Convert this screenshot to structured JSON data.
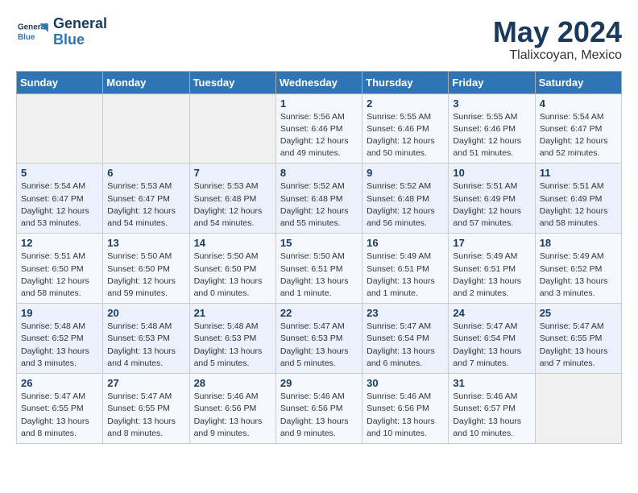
{
  "header": {
    "logo_line1": "General",
    "logo_line2": "Blue",
    "title": "May 2024",
    "subtitle": "Tlalixcoyan, Mexico"
  },
  "weekdays": [
    "Sunday",
    "Monday",
    "Tuesday",
    "Wednesday",
    "Thursday",
    "Friday",
    "Saturday"
  ],
  "weeks": [
    [
      {
        "day": "",
        "info": ""
      },
      {
        "day": "",
        "info": ""
      },
      {
        "day": "",
        "info": ""
      },
      {
        "day": "1",
        "info": "Sunrise: 5:56 AM\nSunset: 6:46 PM\nDaylight: 12 hours\nand 49 minutes."
      },
      {
        "day": "2",
        "info": "Sunrise: 5:55 AM\nSunset: 6:46 PM\nDaylight: 12 hours\nand 50 minutes."
      },
      {
        "day": "3",
        "info": "Sunrise: 5:55 AM\nSunset: 6:46 PM\nDaylight: 12 hours\nand 51 minutes."
      },
      {
        "day": "4",
        "info": "Sunrise: 5:54 AM\nSunset: 6:47 PM\nDaylight: 12 hours\nand 52 minutes."
      }
    ],
    [
      {
        "day": "5",
        "info": "Sunrise: 5:54 AM\nSunset: 6:47 PM\nDaylight: 12 hours\nand 53 minutes."
      },
      {
        "day": "6",
        "info": "Sunrise: 5:53 AM\nSunset: 6:47 PM\nDaylight: 12 hours\nand 54 minutes."
      },
      {
        "day": "7",
        "info": "Sunrise: 5:53 AM\nSunset: 6:48 PM\nDaylight: 12 hours\nand 54 minutes."
      },
      {
        "day": "8",
        "info": "Sunrise: 5:52 AM\nSunset: 6:48 PM\nDaylight: 12 hours\nand 55 minutes."
      },
      {
        "day": "9",
        "info": "Sunrise: 5:52 AM\nSunset: 6:48 PM\nDaylight: 12 hours\nand 56 minutes."
      },
      {
        "day": "10",
        "info": "Sunrise: 5:51 AM\nSunset: 6:49 PM\nDaylight: 12 hours\nand 57 minutes."
      },
      {
        "day": "11",
        "info": "Sunrise: 5:51 AM\nSunset: 6:49 PM\nDaylight: 12 hours\nand 58 minutes."
      }
    ],
    [
      {
        "day": "12",
        "info": "Sunrise: 5:51 AM\nSunset: 6:50 PM\nDaylight: 12 hours\nand 58 minutes."
      },
      {
        "day": "13",
        "info": "Sunrise: 5:50 AM\nSunset: 6:50 PM\nDaylight: 12 hours\nand 59 minutes."
      },
      {
        "day": "14",
        "info": "Sunrise: 5:50 AM\nSunset: 6:50 PM\nDaylight: 13 hours\nand 0 minutes."
      },
      {
        "day": "15",
        "info": "Sunrise: 5:50 AM\nSunset: 6:51 PM\nDaylight: 13 hours\nand 1 minute."
      },
      {
        "day": "16",
        "info": "Sunrise: 5:49 AM\nSunset: 6:51 PM\nDaylight: 13 hours\nand 1 minute."
      },
      {
        "day": "17",
        "info": "Sunrise: 5:49 AM\nSunset: 6:51 PM\nDaylight: 13 hours\nand 2 minutes."
      },
      {
        "day": "18",
        "info": "Sunrise: 5:49 AM\nSunset: 6:52 PM\nDaylight: 13 hours\nand 3 minutes."
      }
    ],
    [
      {
        "day": "19",
        "info": "Sunrise: 5:48 AM\nSunset: 6:52 PM\nDaylight: 13 hours\nand 3 minutes."
      },
      {
        "day": "20",
        "info": "Sunrise: 5:48 AM\nSunset: 6:53 PM\nDaylight: 13 hours\nand 4 minutes."
      },
      {
        "day": "21",
        "info": "Sunrise: 5:48 AM\nSunset: 6:53 PM\nDaylight: 13 hours\nand 5 minutes."
      },
      {
        "day": "22",
        "info": "Sunrise: 5:47 AM\nSunset: 6:53 PM\nDaylight: 13 hours\nand 5 minutes."
      },
      {
        "day": "23",
        "info": "Sunrise: 5:47 AM\nSunset: 6:54 PM\nDaylight: 13 hours\nand 6 minutes."
      },
      {
        "day": "24",
        "info": "Sunrise: 5:47 AM\nSunset: 6:54 PM\nDaylight: 13 hours\nand 7 minutes."
      },
      {
        "day": "25",
        "info": "Sunrise: 5:47 AM\nSunset: 6:55 PM\nDaylight: 13 hours\nand 7 minutes."
      }
    ],
    [
      {
        "day": "26",
        "info": "Sunrise: 5:47 AM\nSunset: 6:55 PM\nDaylight: 13 hours\nand 8 minutes."
      },
      {
        "day": "27",
        "info": "Sunrise: 5:47 AM\nSunset: 6:55 PM\nDaylight: 13 hours\nand 8 minutes."
      },
      {
        "day": "28",
        "info": "Sunrise: 5:46 AM\nSunset: 6:56 PM\nDaylight: 13 hours\nand 9 minutes."
      },
      {
        "day": "29",
        "info": "Sunrise: 5:46 AM\nSunset: 6:56 PM\nDaylight: 13 hours\nand 9 minutes."
      },
      {
        "day": "30",
        "info": "Sunrise: 5:46 AM\nSunset: 6:56 PM\nDaylight: 13 hours\nand 10 minutes."
      },
      {
        "day": "31",
        "info": "Sunrise: 5:46 AM\nSunset: 6:57 PM\nDaylight: 13 hours\nand 10 minutes."
      },
      {
        "day": "",
        "info": ""
      }
    ]
  ]
}
